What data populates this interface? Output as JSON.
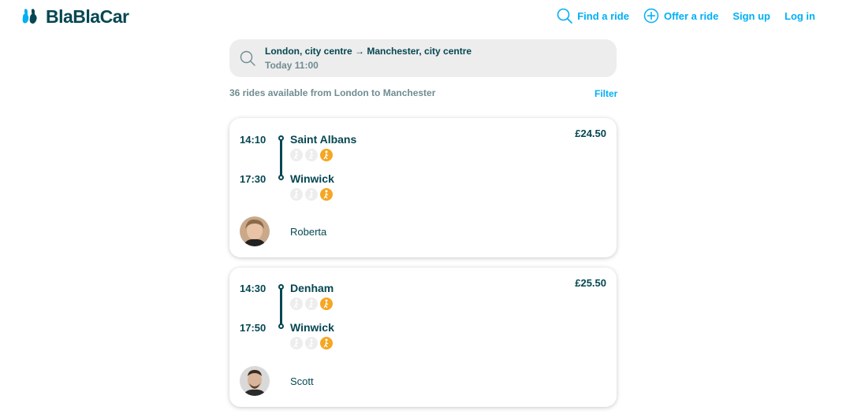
{
  "header": {
    "logo_text": "BlaBlaCar",
    "nav": {
      "find_ride": "Find a ride",
      "offer_ride": "Offer a ride",
      "sign_up": "Sign up",
      "log_in": "Log in"
    }
  },
  "search": {
    "route": "London, city centre → Manchester, city centre",
    "date": "Today 11:00"
  },
  "results": {
    "count_text": "36 rides available from London to Manchester",
    "filter_label": "Filter"
  },
  "rides": [
    {
      "departure_time": "14:10",
      "departure_city": "Saint Albans",
      "arrival_time": "17:30",
      "arrival_city": "Winwick",
      "price": "£24.50",
      "driver": "Roberta"
    },
    {
      "departure_time": "14:30",
      "departure_city": "Denham",
      "arrival_time": "17:50",
      "arrival_city": "Winwick",
      "price": "£25.50",
      "driver": "Scott"
    }
  ],
  "colors": {
    "brand_dark": "#054752",
    "accent_blue": "#00aff5",
    "walk_orange": "#f5a623"
  }
}
